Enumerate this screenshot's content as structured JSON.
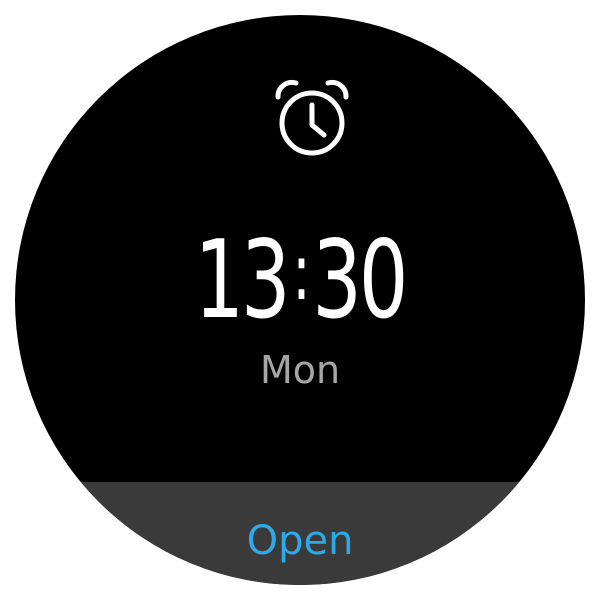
{
  "alarm": {
    "icon": "alarm-clock-icon",
    "hours": "13",
    "separator": ":",
    "minutes": "30",
    "day": "Mon"
  },
  "actions": {
    "open_label": "Open"
  },
  "colors": {
    "background": "#000000",
    "time_text": "#ffffff",
    "day_text": "#a6a6a6",
    "button_bg": "#3a3a3a",
    "accent": "#2ea9e8"
  }
}
